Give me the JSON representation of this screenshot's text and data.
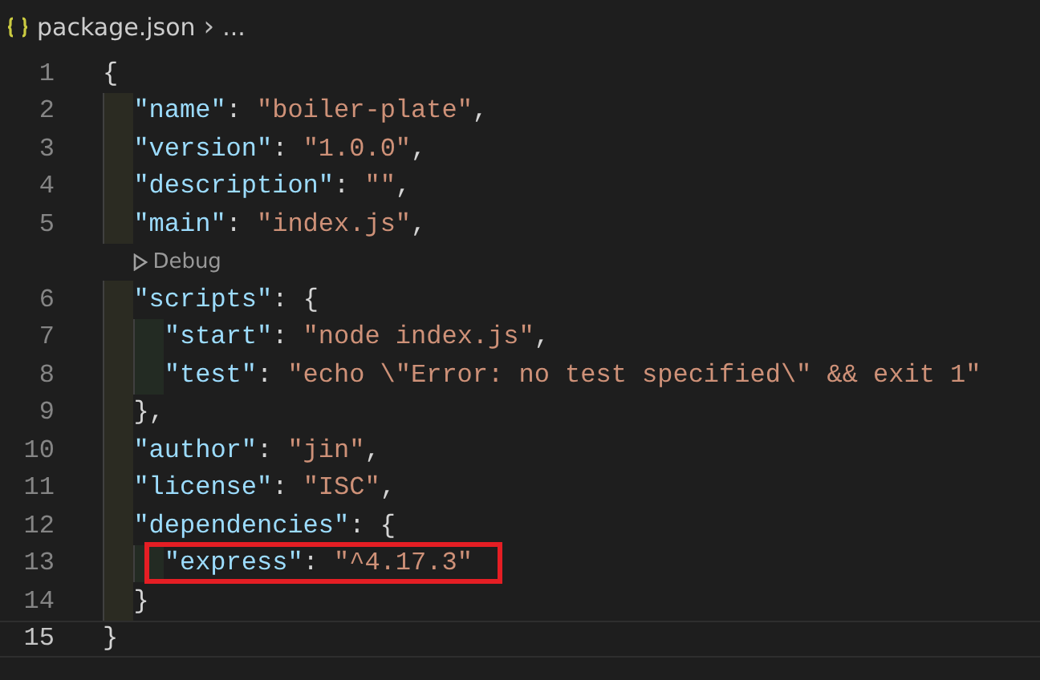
{
  "breadcrumb": {
    "file": "package.json",
    "separator": "›",
    "more": "..."
  },
  "lines": [
    {
      "kind": "code",
      "number": "1",
      "current": false,
      "highlighted": false,
      "tokens": [
        {
          "kind": "punct",
          "text": "{"
        }
      ]
    },
    {
      "kind": "code",
      "number": "2",
      "current": false,
      "highlighted": false,
      "tokens": [
        {
          "kind": "key",
          "text": "  \"name\""
        },
        {
          "kind": "punct",
          "text": ": "
        },
        {
          "kind": "string",
          "text": "\"boiler-plate\""
        },
        {
          "kind": "punct",
          "text": ","
        }
      ]
    },
    {
      "kind": "code",
      "number": "3",
      "current": false,
      "highlighted": false,
      "tokens": [
        {
          "kind": "key",
          "text": "  \"version\""
        },
        {
          "kind": "punct",
          "text": ": "
        },
        {
          "kind": "string",
          "text": "\"1.0.0\""
        },
        {
          "kind": "punct",
          "text": ","
        }
      ]
    },
    {
      "kind": "code",
      "number": "4",
      "current": false,
      "highlighted": false,
      "tokens": [
        {
          "kind": "key",
          "text": "  \"description\""
        },
        {
          "kind": "punct",
          "text": ": "
        },
        {
          "kind": "string",
          "text": "\"\""
        },
        {
          "kind": "punct",
          "text": ","
        }
      ]
    },
    {
      "kind": "code",
      "number": "5",
      "current": false,
      "highlighted": false,
      "tokens": [
        {
          "kind": "key",
          "text": "  \"main\""
        },
        {
          "kind": "punct",
          "text": ": "
        },
        {
          "kind": "string",
          "text": "\"index.js\""
        },
        {
          "kind": "punct",
          "text": ","
        }
      ]
    },
    {
      "kind": "codelens",
      "text": "Debug"
    },
    {
      "kind": "code",
      "number": "6",
      "current": false,
      "highlighted": false,
      "tokens": [
        {
          "kind": "key",
          "text": "  \"scripts\""
        },
        {
          "kind": "punct",
          "text": ": {"
        }
      ]
    },
    {
      "kind": "code",
      "number": "7",
      "current": false,
      "highlighted": false,
      "tokens": [
        {
          "kind": "key",
          "text": "    \"start\""
        },
        {
          "kind": "punct",
          "text": ": "
        },
        {
          "kind": "string",
          "text": "\"node index.js\""
        },
        {
          "kind": "punct",
          "text": ","
        }
      ]
    },
    {
      "kind": "code",
      "number": "8",
      "current": false,
      "highlighted": false,
      "tokens": [
        {
          "kind": "key",
          "text": "    \"test\""
        },
        {
          "kind": "punct",
          "text": ": "
        },
        {
          "kind": "string",
          "text": "\"echo \\\"Error: no test specified\\\" && exit 1\""
        }
      ]
    },
    {
      "kind": "code",
      "number": "9",
      "current": false,
      "highlighted": false,
      "tokens": [
        {
          "kind": "punct",
          "text": "  },"
        }
      ]
    },
    {
      "kind": "code",
      "number": "10",
      "current": false,
      "highlighted": false,
      "tokens": [
        {
          "kind": "key",
          "text": "  \"author\""
        },
        {
          "kind": "punct",
          "text": ": "
        },
        {
          "kind": "string",
          "text": "\"jin\""
        },
        {
          "kind": "punct",
          "text": ","
        }
      ]
    },
    {
      "kind": "code",
      "number": "11",
      "current": false,
      "highlighted": false,
      "tokens": [
        {
          "kind": "key",
          "text": "  \"license\""
        },
        {
          "kind": "punct",
          "text": ": "
        },
        {
          "kind": "string",
          "text": "\"ISC\""
        },
        {
          "kind": "punct",
          "text": ","
        }
      ]
    },
    {
      "kind": "code",
      "number": "12",
      "current": false,
      "highlighted": false,
      "tokens": [
        {
          "kind": "key",
          "text": "  \"dependencies\""
        },
        {
          "kind": "punct",
          "text": ": {"
        }
      ]
    },
    {
      "kind": "code",
      "number": "13",
      "current": false,
      "highlighted": true,
      "tokens": [
        {
          "kind": "key",
          "text": "    \"express\""
        },
        {
          "kind": "punct",
          "text": ": "
        },
        {
          "kind": "string",
          "text": "\"^4.17.3\""
        }
      ]
    },
    {
      "kind": "code",
      "number": "14",
      "current": false,
      "highlighted": false,
      "tokens": [
        {
          "kind": "punct",
          "text": "  }"
        }
      ]
    },
    {
      "kind": "code",
      "number": "15",
      "current": true,
      "highlighted": false,
      "tokens": [
        {
          "kind": "punct",
          "text": "}"
        }
      ]
    }
  ]
}
